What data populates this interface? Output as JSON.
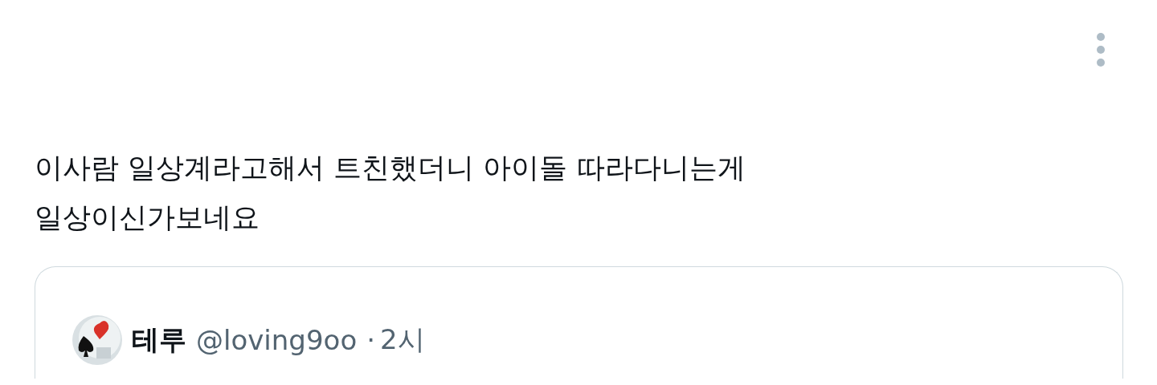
{
  "tweet": {
    "text_lines": [
      "이사람 일상계라고해서 트친했더니 아이돌 따라다니는게",
      "일상이신가보네요"
    ],
    "quoted": {
      "name": "테루",
      "handle": "@loving9oo",
      "separator": "·",
      "time": "2시"
    }
  }
}
